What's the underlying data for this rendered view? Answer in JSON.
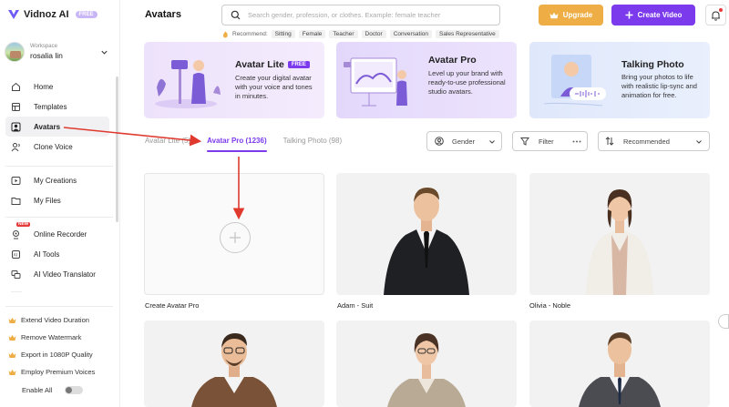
{
  "app": {
    "name": "Vidnoz AI",
    "badge": "FREE"
  },
  "workspace": {
    "label": "Workspace",
    "name": "rosalia lin"
  },
  "nav": {
    "home": "Home",
    "templates": "Templates",
    "avatars": "Avatars",
    "clone_voice": "Clone Voice",
    "my_creations": "My Creations",
    "my_files": "My Files",
    "online_recorder": "Online Recorder",
    "online_recorder_tag": "NEW",
    "ai_tools": "AI Tools",
    "ai_video_translator": "AI Video Translator"
  },
  "promos": [
    "Extend Video Duration",
    "Remove Watermark",
    "Export in 1080P Quality",
    "Employ Premium Voices"
  ],
  "enable_all": "Enable All",
  "header": {
    "title": "Avatars",
    "search_placeholder": "Search gender, profession, or clothes. Example: female teacher",
    "recommend_label": "Recommend:",
    "recommend_chips": [
      "Sitting",
      "Female",
      "Teacher",
      "Doctor",
      "Conversation",
      "Sales Representative"
    ],
    "upgrade": "Upgrade",
    "create_video": "Create Video"
  },
  "banners": {
    "lite": {
      "title": "Avatar Lite",
      "badge": "FREE",
      "desc": "Create your digital avatar with your voice and tones in minutes."
    },
    "pro": {
      "title": "Avatar Pro",
      "desc": "Level up your brand with ready-to-use professional studio avatars."
    },
    "talking": {
      "title": "Talking Photo",
      "desc": "Bring your photos to life with realistic lip-sync and animation for free."
    }
  },
  "tabs": {
    "lite": "Avatar Lite (5)",
    "pro": "Avatar Pro (1236)",
    "talking": "Talking Photo (98)"
  },
  "filters": {
    "gender": "Gender",
    "filter": "Filter",
    "sort": "Recommended"
  },
  "cards": {
    "create": "Create Avatar Pro",
    "adam": "Adam - Suit",
    "olivia": "Olivia - Noble"
  },
  "colors": {
    "accent": "#7c3aed",
    "upgrade": "#efae45",
    "annotation": "#e03a2f"
  }
}
